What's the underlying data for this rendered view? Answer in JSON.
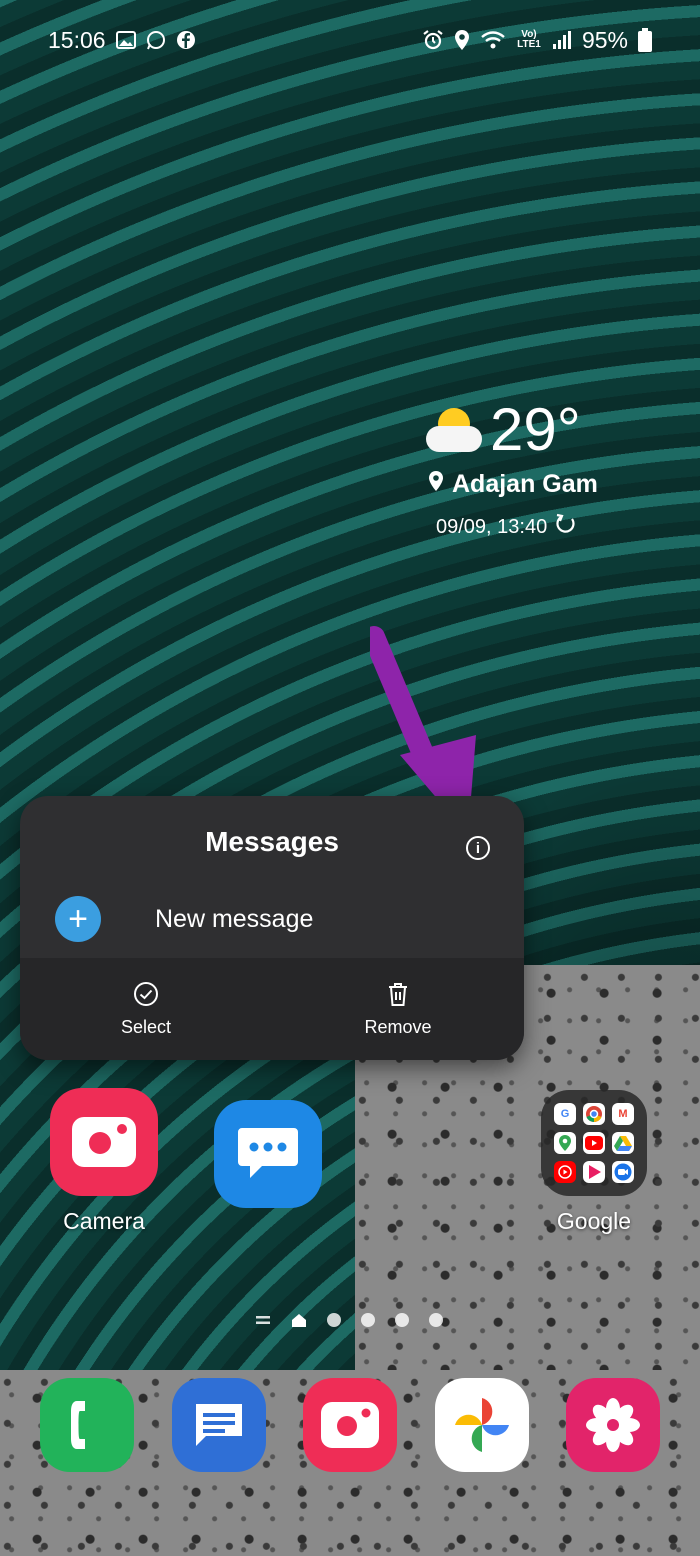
{
  "status_bar": {
    "time": "15:06",
    "left_icons": [
      "gallery-icon",
      "whatsapp-icon",
      "facebook-icon"
    ],
    "right_icons": [
      "alarm-icon",
      "location-icon",
      "wifi-icon",
      "volte-icon",
      "signal-icon"
    ],
    "volte_text": "Vo) LTE1",
    "battery": "95%"
  },
  "weather": {
    "temperature": "29°",
    "location": "Adajan Gam",
    "updated": "09/09, 13:40"
  },
  "popup": {
    "title": "Messages",
    "new_message": "New message",
    "select_label": "Select",
    "remove_label": "Remove"
  },
  "apps": {
    "camera": "Camera",
    "google": "Google"
  },
  "page_indicator": {
    "pages": 4,
    "current": "home"
  },
  "colors": {
    "arrow": "#8e24aa",
    "camera": "#ef2d56",
    "messages": "#1e88e5",
    "phone": "#22b35a",
    "samsung_messages": "#2f6fd6",
    "blossom": "#e2246a",
    "popup_bg": "#2f2f31"
  }
}
